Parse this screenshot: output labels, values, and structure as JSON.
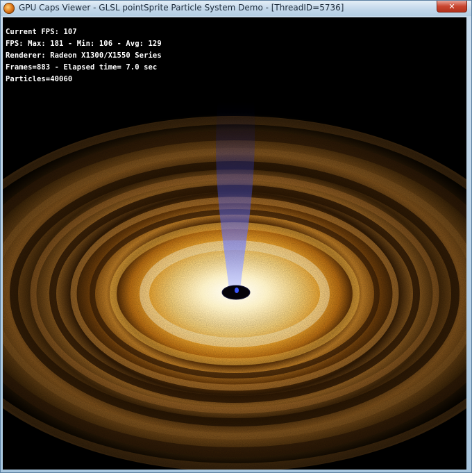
{
  "window": {
    "title": "GPU Caps Viewer - GLSL pointSprite Particle System Demo - [ThreadID=5736]",
    "close_label": "✕"
  },
  "stats": {
    "current_fps": "Current FPS: 107",
    "fps_summary": "FPS: Max: 181 - Min: 106 - Avg: 129",
    "renderer": "Renderer: Radeon X1300/X1550 Series",
    "frames": "Frames=883 - Elapsed time= 7.0 sec",
    "particles": "Particles=40060"
  },
  "colors": {
    "background": "#000000",
    "disc_core": "#fff6d6",
    "disc_mid": "#e9a12a",
    "disc_outer": "#7a4a12",
    "jet": "#4a5cff"
  }
}
